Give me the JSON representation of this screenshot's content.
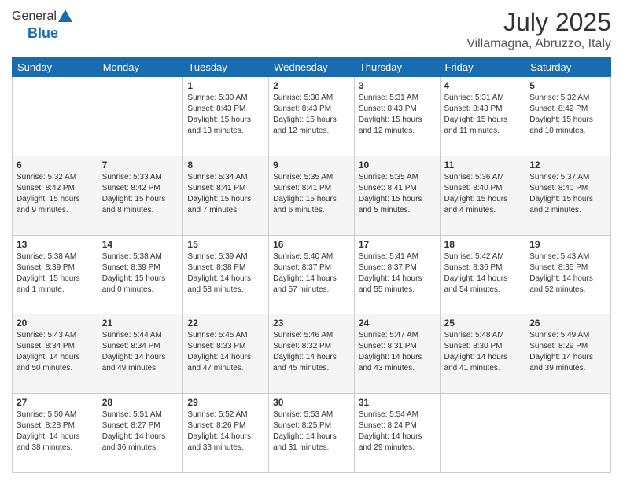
{
  "header": {
    "logo_general": "General",
    "logo_blue": "Blue",
    "month_title": "July 2025",
    "location": "Villamagna, Abruzzo, Italy"
  },
  "weekdays": [
    "Sunday",
    "Monday",
    "Tuesday",
    "Wednesday",
    "Thursday",
    "Friday",
    "Saturday"
  ],
  "weeks": [
    [
      null,
      null,
      {
        "day": 1,
        "sunrise": "5:30 AM",
        "sunset": "8:43 PM",
        "daylight": "15 hours and 13 minutes."
      },
      {
        "day": 2,
        "sunrise": "5:30 AM",
        "sunset": "8:43 PM",
        "daylight": "15 hours and 12 minutes."
      },
      {
        "day": 3,
        "sunrise": "5:31 AM",
        "sunset": "8:43 PM",
        "daylight": "15 hours and 12 minutes."
      },
      {
        "day": 4,
        "sunrise": "5:31 AM",
        "sunset": "8:43 PM",
        "daylight": "15 hours and 11 minutes."
      },
      {
        "day": 5,
        "sunrise": "5:32 AM",
        "sunset": "8:42 PM",
        "daylight": "15 hours and 10 minutes."
      }
    ],
    [
      {
        "day": 6,
        "sunrise": "5:32 AM",
        "sunset": "8:42 PM",
        "daylight": "15 hours and 9 minutes."
      },
      {
        "day": 7,
        "sunrise": "5:33 AM",
        "sunset": "8:42 PM",
        "daylight": "15 hours and 8 minutes."
      },
      {
        "day": 8,
        "sunrise": "5:34 AM",
        "sunset": "8:41 PM",
        "daylight": "15 hours and 7 minutes."
      },
      {
        "day": 9,
        "sunrise": "5:35 AM",
        "sunset": "8:41 PM",
        "daylight": "15 hours and 6 minutes."
      },
      {
        "day": 10,
        "sunrise": "5:35 AM",
        "sunset": "8:41 PM",
        "daylight": "15 hours and 5 minutes."
      },
      {
        "day": 11,
        "sunrise": "5:36 AM",
        "sunset": "8:40 PM",
        "daylight": "15 hours and 4 minutes."
      },
      {
        "day": 12,
        "sunrise": "5:37 AM",
        "sunset": "8:40 PM",
        "daylight": "15 hours and 2 minutes."
      }
    ],
    [
      {
        "day": 13,
        "sunrise": "5:38 AM",
        "sunset": "8:39 PM",
        "daylight": "15 hours and 1 minute."
      },
      {
        "day": 14,
        "sunrise": "5:38 AM",
        "sunset": "8:39 PM",
        "daylight": "15 hours and 0 minutes."
      },
      {
        "day": 15,
        "sunrise": "5:39 AM",
        "sunset": "8:38 PM",
        "daylight": "14 hours and 58 minutes."
      },
      {
        "day": 16,
        "sunrise": "5:40 AM",
        "sunset": "8:37 PM",
        "daylight": "14 hours and 57 minutes."
      },
      {
        "day": 17,
        "sunrise": "5:41 AM",
        "sunset": "8:37 PM",
        "daylight": "14 hours and 55 minutes."
      },
      {
        "day": 18,
        "sunrise": "5:42 AM",
        "sunset": "8:36 PM",
        "daylight": "14 hours and 54 minutes."
      },
      {
        "day": 19,
        "sunrise": "5:43 AM",
        "sunset": "8:35 PM",
        "daylight": "14 hours and 52 minutes."
      }
    ],
    [
      {
        "day": 20,
        "sunrise": "5:43 AM",
        "sunset": "8:34 PM",
        "daylight": "14 hours and 50 minutes."
      },
      {
        "day": 21,
        "sunrise": "5:44 AM",
        "sunset": "8:34 PM",
        "daylight": "14 hours and 49 minutes."
      },
      {
        "day": 22,
        "sunrise": "5:45 AM",
        "sunset": "8:33 PM",
        "daylight": "14 hours and 47 minutes."
      },
      {
        "day": 23,
        "sunrise": "5:46 AM",
        "sunset": "8:32 PM",
        "daylight": "14 hours and 45 minutes."
      },
      {
        "day": 24,
        "sunrise": "5:47 AM",
        "sunset": "8:31 PM",
        "daylight": "14 hours and 43 minutes."
      },
      {
        "day": 25,
        "sunrise": "5:48 AM",
        "sunset": "8:30 PM",
        "daylight": "14 hours and 41 minutes."
      },
      {
        "day": 26,
        "sunrise": "5:49 AM",
        "sunset": "8:29 PM",
        "daylight": "14 hours and 39 minutes."
      }
    ],
    [
      {
        "day": 27,
        "sunrise": "5:50 AM",
        "sunset": "8:28 PM",
        "daylight": "14 hours and 38 minutes."
      },
      {
        "day": 28,
        "sunrise": "5:51 AM",
        "sunset": "8:27 PM",
        "daylight": "14 hours and 36 minutes."
      },
      {
        "day": 29,
        "sunrise": "5:52 AM",
        "sunset": "8:26 PM",
        "daylight": "14 hours and 33 minutes."
      },
      {
        "day": 30,
        "sunrise": "5:53 AM",
        "sunset": "8:25 PM",
        "daylight": "14 hours and 31 minutes."
      },
      {
        "day": 31,
        "sunrise": "5:54 AM",
        "sunset": "8:24 PM",
        "daylight": "14 hours and 29 minutes."
      },
      null,
      null
    ]
  ]
}
